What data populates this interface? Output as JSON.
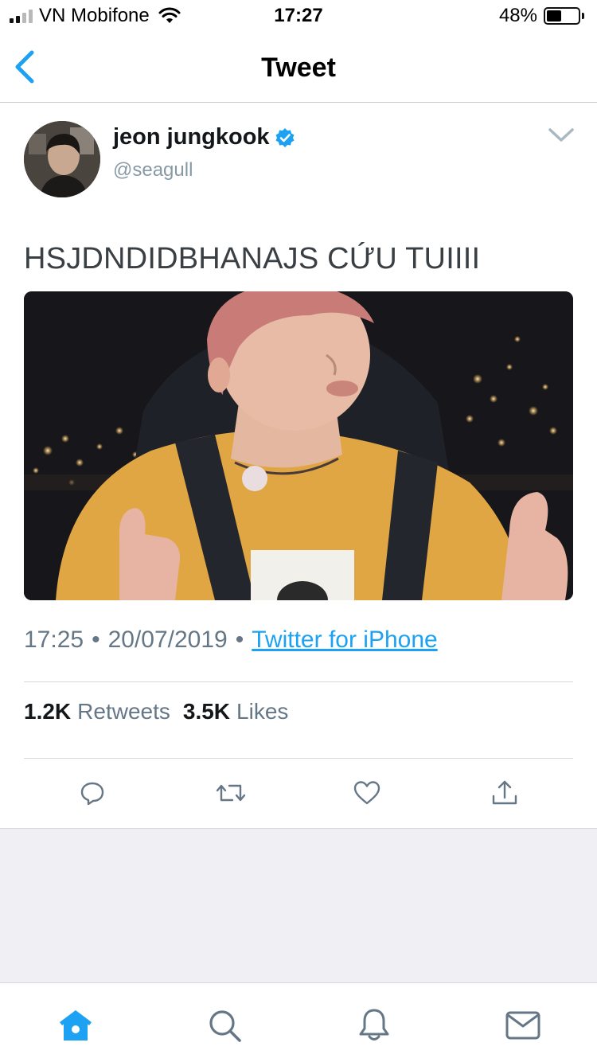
{
  "status_bar": {
    "carrier": "VN Mobifone",
    "time": "17:27",
    "battery_percent": "48%",
    "battery_level": 0.48,
    "signal_bars_filled": 2,
    "signal_bars_total": 4
  },
  "header": {
    "title": "Tweet",
    "back_icon": "chevron-left-icon"
  },
  "tweet": {
    "display_name": "jeon jungkook",
    "handle": "@seagull",
    "verified": true,
    "text": "HSJDNDIDBHANAJS CỨU TUIIII",
    "time": "17:25",
    "separator": "•",
    "date": "20/07/2019",
    "source": "Twitter for iPhone",
    "retweets_count": "1.2K",
    "retweets_label": "Retweets",
    "likes_count": "3.5K",
    "likes_label": "Likes"
  },
  "actions": [
    "reply-icon",
    "retweet-icon",
    "like-icon",
    "share-icon"
  ],
  "tab_bar": [
    "home-icon",
    "search-icon",
    "notifications-icon",
    "messages-icon"
  ],
  "colors": {
    "accent": "#1da1f2",
    "muted_text": "#657786",
    "action_icon": "#657786",
    "background_gray": "#efeff4"
  }
}
